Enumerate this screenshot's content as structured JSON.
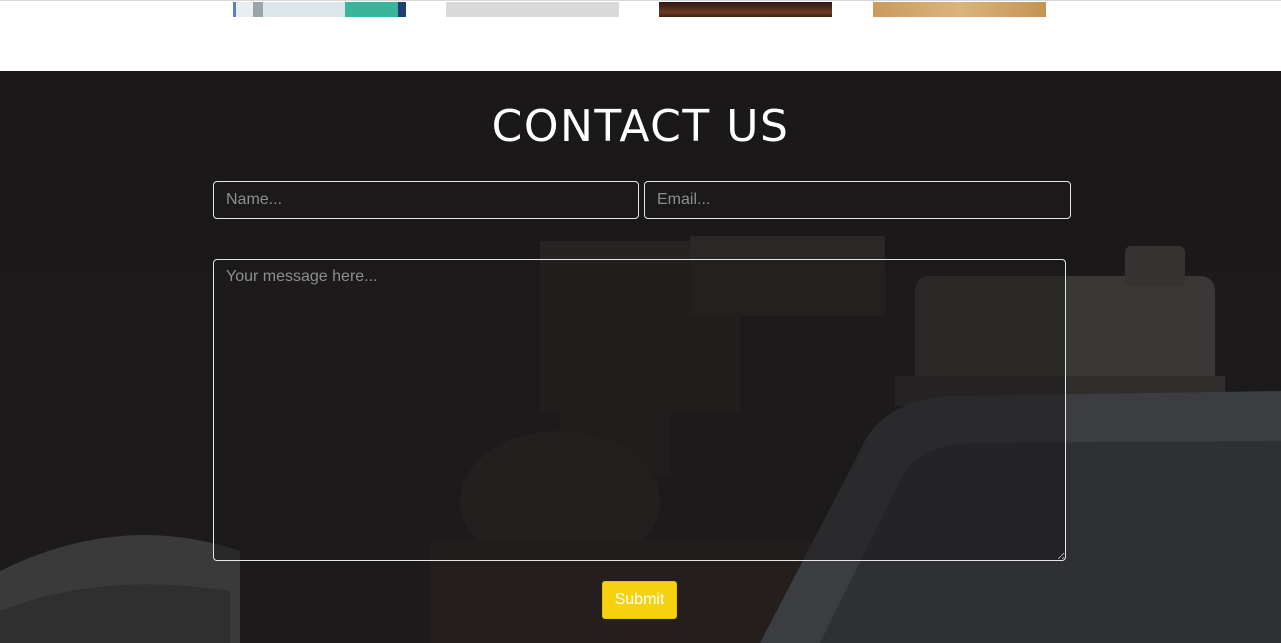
{
  "contact": {
    "title": "CONTACT US",
    "name_placeholder": "Name...",
    "email_placeholder": "Email...",
    "message_placeholder": "Your message here...",
    "submit_label": "Submit"
  },
  "colors": {
    "section_background": "#1b1919",
    "submit_background": "#f5d20f",
    "field_border": "#e6e6e6"
  }
}
